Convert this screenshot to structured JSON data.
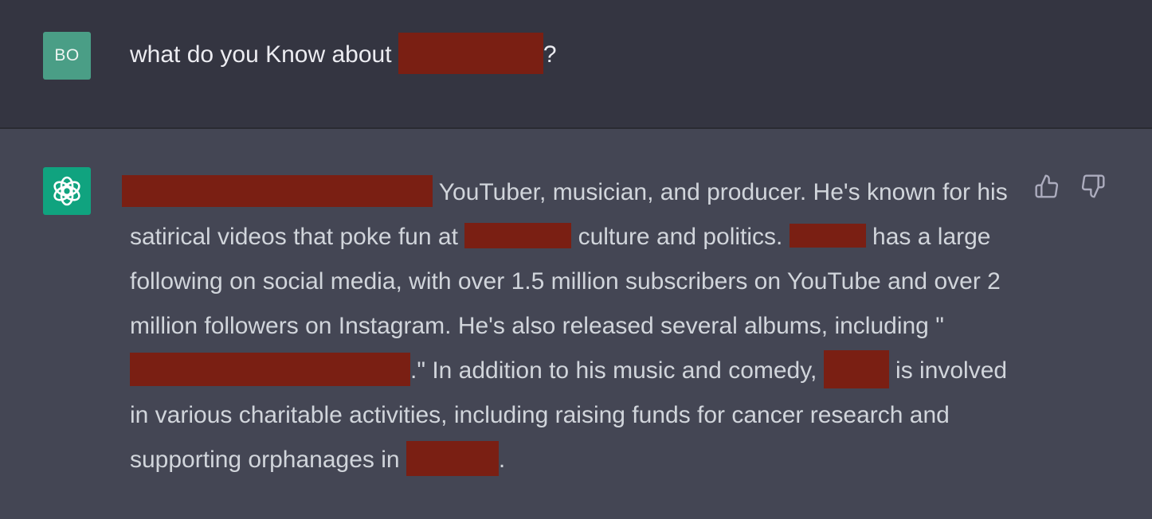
{
  "user_message": {
    "avatar_initials": "BO",
    "avatar_color": "#4a9e86",
    "text_before": "what do you Know about ",
    "text_after": "?"
  },
  "assistant_message": {
    "avatar_icon": "openai-logo-icon",
    "avatar_color": "#10a37f",
    "segments": {
      "s1": " YouTuber, musician, and producer. He's known for his satirical videos that poke fun at ",
      "s2": " culture and politics. ",
      "s3": " has a large following on social media, with over 1.5 million subscribers on YouTube and over 2 million followers on Instagram. He's also released several albums, including \"",
      "s4": ".\" In addition to his music and comedy, ",
      "s5": " is involved in various charitable activities, including raising funds for cancer research and supporting orphanages in ",
      "s6": "."
    },
    "actions": {
      "thumbs_up_icon": "thumbs-up-icon",
      "thumbs_down_icon": "thumbs-down-icon"
    }
  },
  "colors": {
    "user_bg": "#343541",
    "assistant_bg": "#444654",
    "redaction": "#7a1f13"
  }
}
